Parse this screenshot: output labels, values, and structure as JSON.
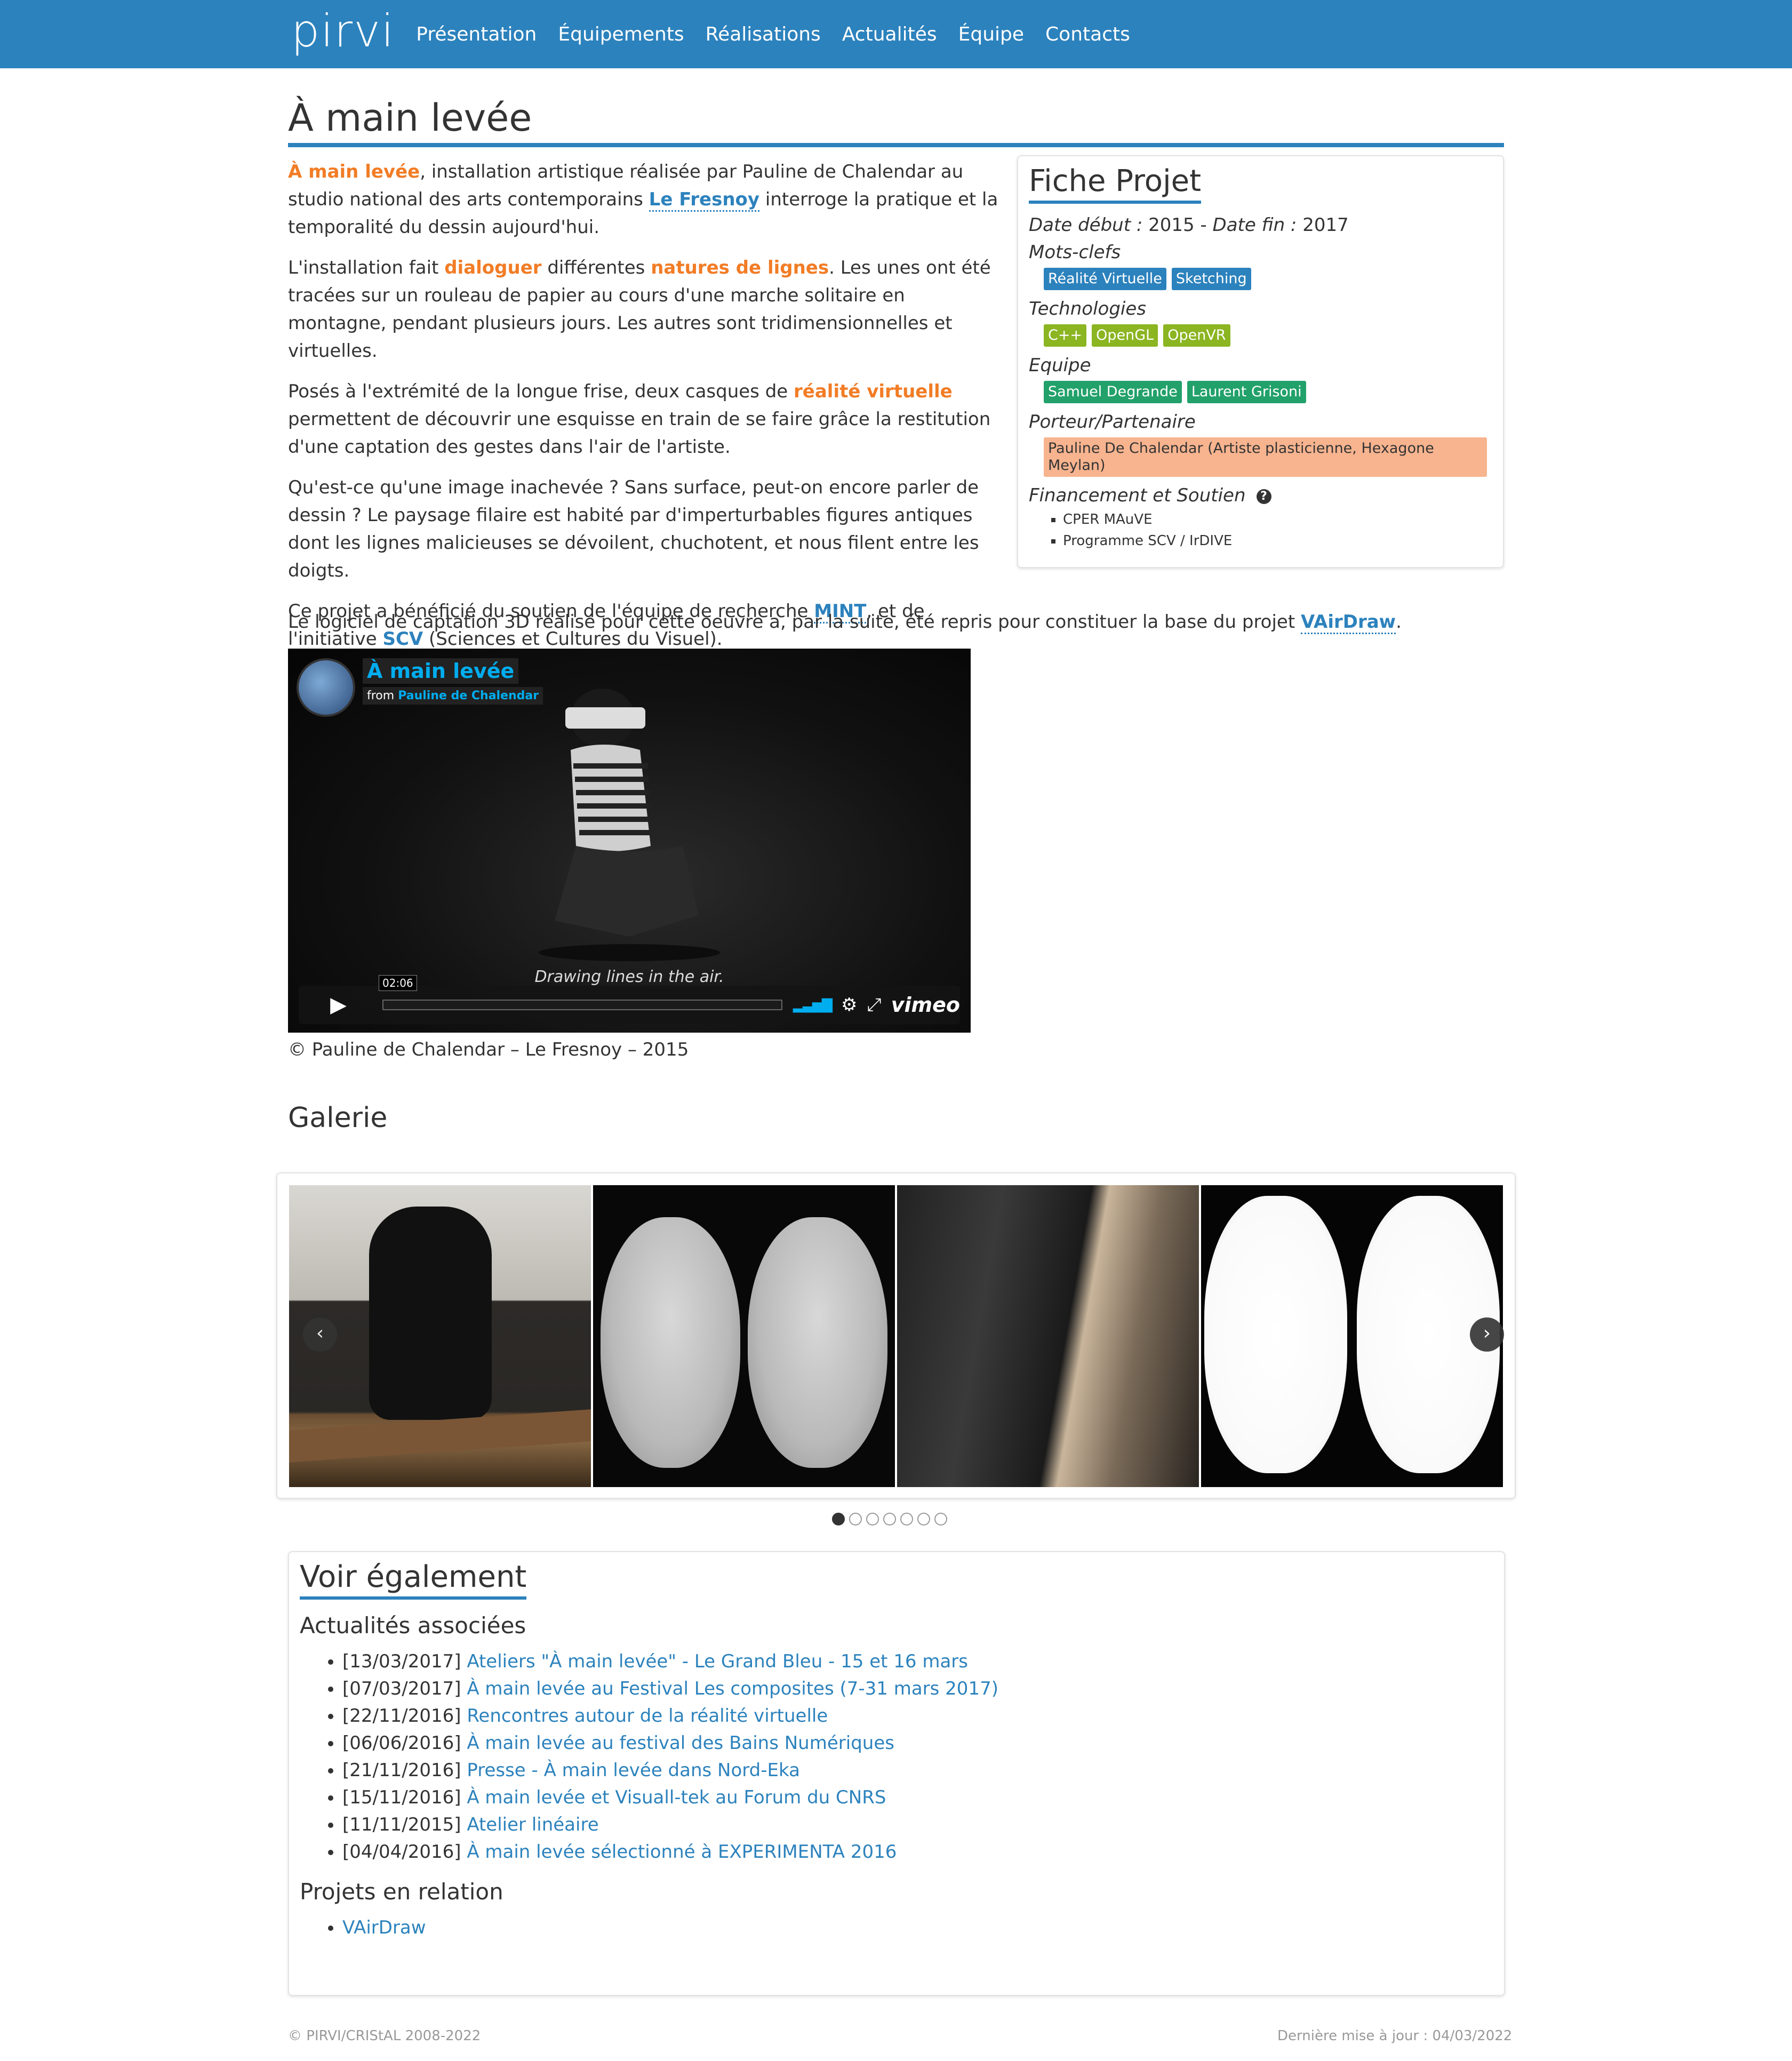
{
  "nav": {
    "logo": "pirvi",
    "items": [
      {
        "label": "Présentation"
      },
      {
        "label": "Équipements"
      },
      {
        "label": "Réalisations"
      },
      {
        "label": "Actualités"
      },
      {
        "label": "Équipe"
      },
      {
        "label": "Contacts"
      }
    ]
  },
  "page": {
    "title": "À main levée"
  },
  "intro": {
    "p1_hl": "À main levée",
    "p1_a": ", installation artistique réalisée par Pauline de Chalendar au studio national des arts contemporains ",
    "p1_link": "Le Fresnoy",
    "p1_b": " interroge la pratique et la temporalité du dessin aujourd'hui.",
    "p2_a": "L'installation fait ",
    "p2_hl1": "dialoguer",
    "p2_b": " différentes ",
    "p2_hl2": "natures de lignes",
    "p2_c": ". Les unes ont été tracées sur un rouleau de papier au cours d'une marche solitaire en montagne, pendant plusieurs jours. Les autres sont tridimensionnelles et virtuelles.",
    "p3_a": "Posés à l'extrémité de la longue frise, deux casques de ",
    "p3_hl": "réalité virtuelle",
    "p3_b": " permettent de découvrir une esquisse en train de se faire grâce la restitution d'une captation des gestes dans l'air de l'artiste.",
    "p4": "Qu'est-ce qu'une image inachevée ? Sans surface, peut-on encore parler de dessin ? Le paysage filaire est habité par d'imperturbables figures antiques dont les lignes malicieuses se dévoilent, chuchotent, et nous filent entre les doigts.",
    "p5_a": "Ce projet a bénéficié du soutien de l'équipe de recherche ",
    "p5_link1": "MINT",
    "p5_b": ", et de l'initiative ",
    "p5_link2": "SCV",
    "p5_c": " (Sciences et Cultures du Visuel).",
    "p6_a": "Le logiciel de captation 3D réalisé pour cette oeuvre a, par la suite, été repris pour constituer la base du projet ",
    "p6_link": "VAirDraw",
    "p6_b": "."
  },
  "fiche": {
    "title": "Fiche Projet",
    "date_start_label": "Date début :",
    "date_start": "2015",
    "date_sep": " - ",
    "date_end_label": "Date fin :",
    "date_end": "2017",
    "keywords_label": "Mots-clefs",
    "keywords": [
      "Réalité Virtuelle",
      "Sketching"
    ],
    "tech_label": "Technologies",
    "tech": [
      "C++",
      "OpenGL",
      "OpenVR"
    ],
    "team_label": "Equipe",
    "team": [
      "Samuel Degrande",
      "Laurent Grisoni"
    ],
    "partner_label": "Porteur/Partenaire",
    "partner": "Pauline De Chalendar (Artiste plasticienne, Hexagone Meylan)",
    "funding_label": "Financement et Soutien",
    "help_icon": "?",
    "funding": [
      "CPER MAuVE",
      "Programme SCV / IrDIVE"
    ]
  },
  "video": {
    "title": "À main levée",
    "from": "from",
    "author": "Pauline de Chalendar",
    "caption": "Drawing lines in the air.",
    "time": "02:06",
    "play_icon": "▶",
    "brand": "vimeo",
    "credit": "© Pauline de Chalendar – Le Fresnoy – 2015",
    "progress": 0
  },
  "gallery": {
    "title": "Galerie",
    "prev": "‹",
    "next": "›",
    "dots": 7,
    "active_dot": 0
  },
  "see_also": {
    "title": "Voir également",
    "news_title": "Actualités associées",
    "news": [
      {
        "date": "[13/03/2017]",
        "label": "Ateliers \"À main levée\" - Le Grand Bleu - 15 et 16 mars"
      },
      {
        "date": "[07/03/2017]",
        "label": "À main levée au Festival Les composites (7-31 mars 2017)"
      },
      {
        "date": "[22/11/2016]",
        "label": "Rencontres autour de la réalité virtuelle"
      },
      {
        "date": "[06/06/2016]",
        "label": "À main levée au festival des Bains Numériques"
      },
      {
        "date": "[21/11/2016]",
        "label": "Presse - À main levée dans Nord-Eka"
      },
      {
        "date": "[15/11/2016]",
        "label": "À main levée et Visuall-tek au Forum du CNRS"
      },
      {
        "date": "[11/11/2015]",
        "label": "Atelier linéaire"
      },
      {
        "date": "[04/04/2016]",
        "label": "À main levée sélectionné à EXPERIMENTA 2016"
      }
    ],
    "related_title": "Projets en relation",
    "related": [
      {
        "label": "VAirDraw"
      }
    ]
  },
  "footer": {
    "left": "© PIRVI/CRIStAL 2008-2022",
    "right": "Dernière mise à jour : 04/03/2022"
  },
  "colors": {
    "nav_bg": "#2c82bd",
    "accent": "#2c82bd",
    "highlight": "#f27c25",
    "tag_keyword": "#2c82bd",
    "tag_tech": "#8bb521",
    "tag_team": "#22a16a",
    "tag_partner": "#f7b48f"
  }
}
